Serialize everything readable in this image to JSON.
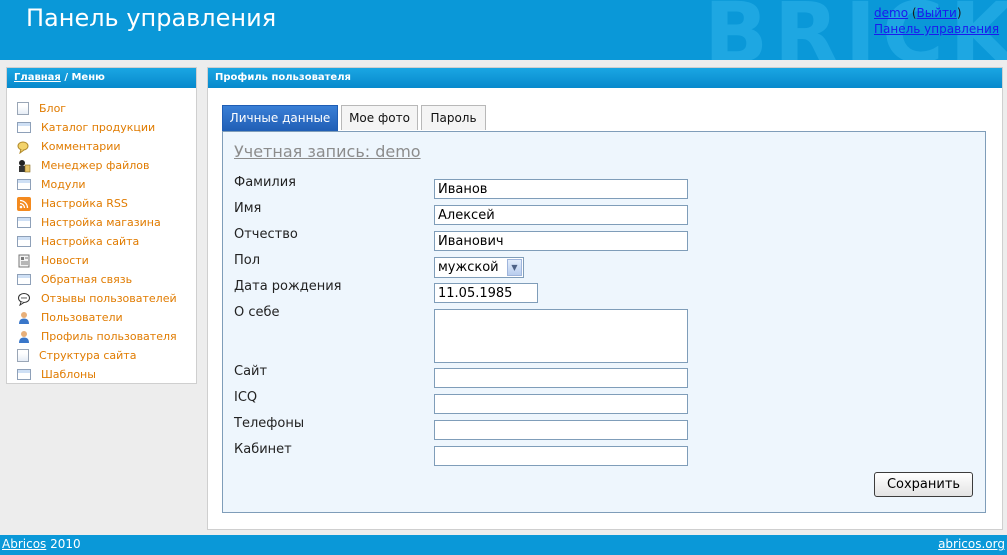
{
  "header": {
    "title": "Панель управления",
    "watermark": "BRICK",
    "user_name": "demo",
    "paren_open": " (",
    "logout": "Выйти",
    "paren_close": ")",
    "control_panel_link": "Панель управления"
  },
  "sidebar": {
    "breadcrumb_home": "Главная",
    "breadcrumb_sep": " / ",
    "breadcrumb_current": "Меню",
    "items": [
      {
        "label": "Блог",
        "icon": "blog-icon"
      },
      {
        "label": "Каталог продукции",
        "icon": "window-icon"
      },
      {
        "label": "Комментарии",
        "icon": "comments-icon"
      },
      {
        "label": "Менеджер файлов",
        "icon": "file-manager-icon"
      },
      {
        "label": "Модули",
        "icon": "window-icon"
      },
      {
        "label": "Настройка RSS",
        "icon": "rss-icon"
      },
      {
        "label": "Настройка магазина",
        "icon": "window-icon"
      },
      {
        "label": "Настройка сайта",
        "icon": "window-icon"
      },
      {
        "label": "Новости",
        "icon": "news-icon"
      },
      {
        "label": "Обратная связь",
        "icon": "window-icon"
      },
      {
        "label": "Отзывы пользователей",
        "icon": "feedback-icon"
      },
      {
        "label": "Пользователи",
        "icon": "user-icon"
      },
      {
        "label": "Профиль пользователя",
        "icon": "user-icon"
      },
      {
        "label": "Структура сайта",
        "icon": "document-icon"
      },
      {
        "label": "Шаблоны",
        "icon": "window-icon"
      }
    ]
  },
  "main": {
    "panel_title": "Профиль пользователя",
    "tabs": [
      {
        "label": "Личные данные",
        "active": true
      },
      {
        "label": "Мое фото",
        "active": false
      },
      {
        "label": "Пароль",
        "active": false
      }
    ],
    "account_title": "Учетная запись: demo",
    "fields": {
      "lastname": {
        "label": "Фамилия",
        "value": "Иванов"
      },
      "firstname": {
        "label": "Имя",
        "value": "Алексей"
      },
      "middlename": {
        "label": "Отчество",
        "value": "Иванович"
      },
      "gender": {
        "label": "Пол",
        "value": "мужской"
      },
      "birthdate": {
        "label": "Дата рождения",
        "value": "11.05.1985"
      },
      "about": {
        "label": "О себе",
        "value": ""
      },
      "site": {
        "label": "Сайт",
        "value": ""
      },
      "icq": {
        "label": "ICQ",
        "value": ""
      },
      "phones": {
        "label": "Телефоны",
        "value": ""
      },
      "office": {
        "label": "Кабинет",
        "value": ""
      }
    },
    "save_label": "Сохранить"
  },
  "footer": {
    "left_link": "Abricos",
    "year": " 2010",
    "right_link": "abricos.org"
  },
  "colors": {
    "header_bg": "#0a98d8",
    "menu_link": "#e07b00",
    "tab_active": "#1f5db4"
  }
}
